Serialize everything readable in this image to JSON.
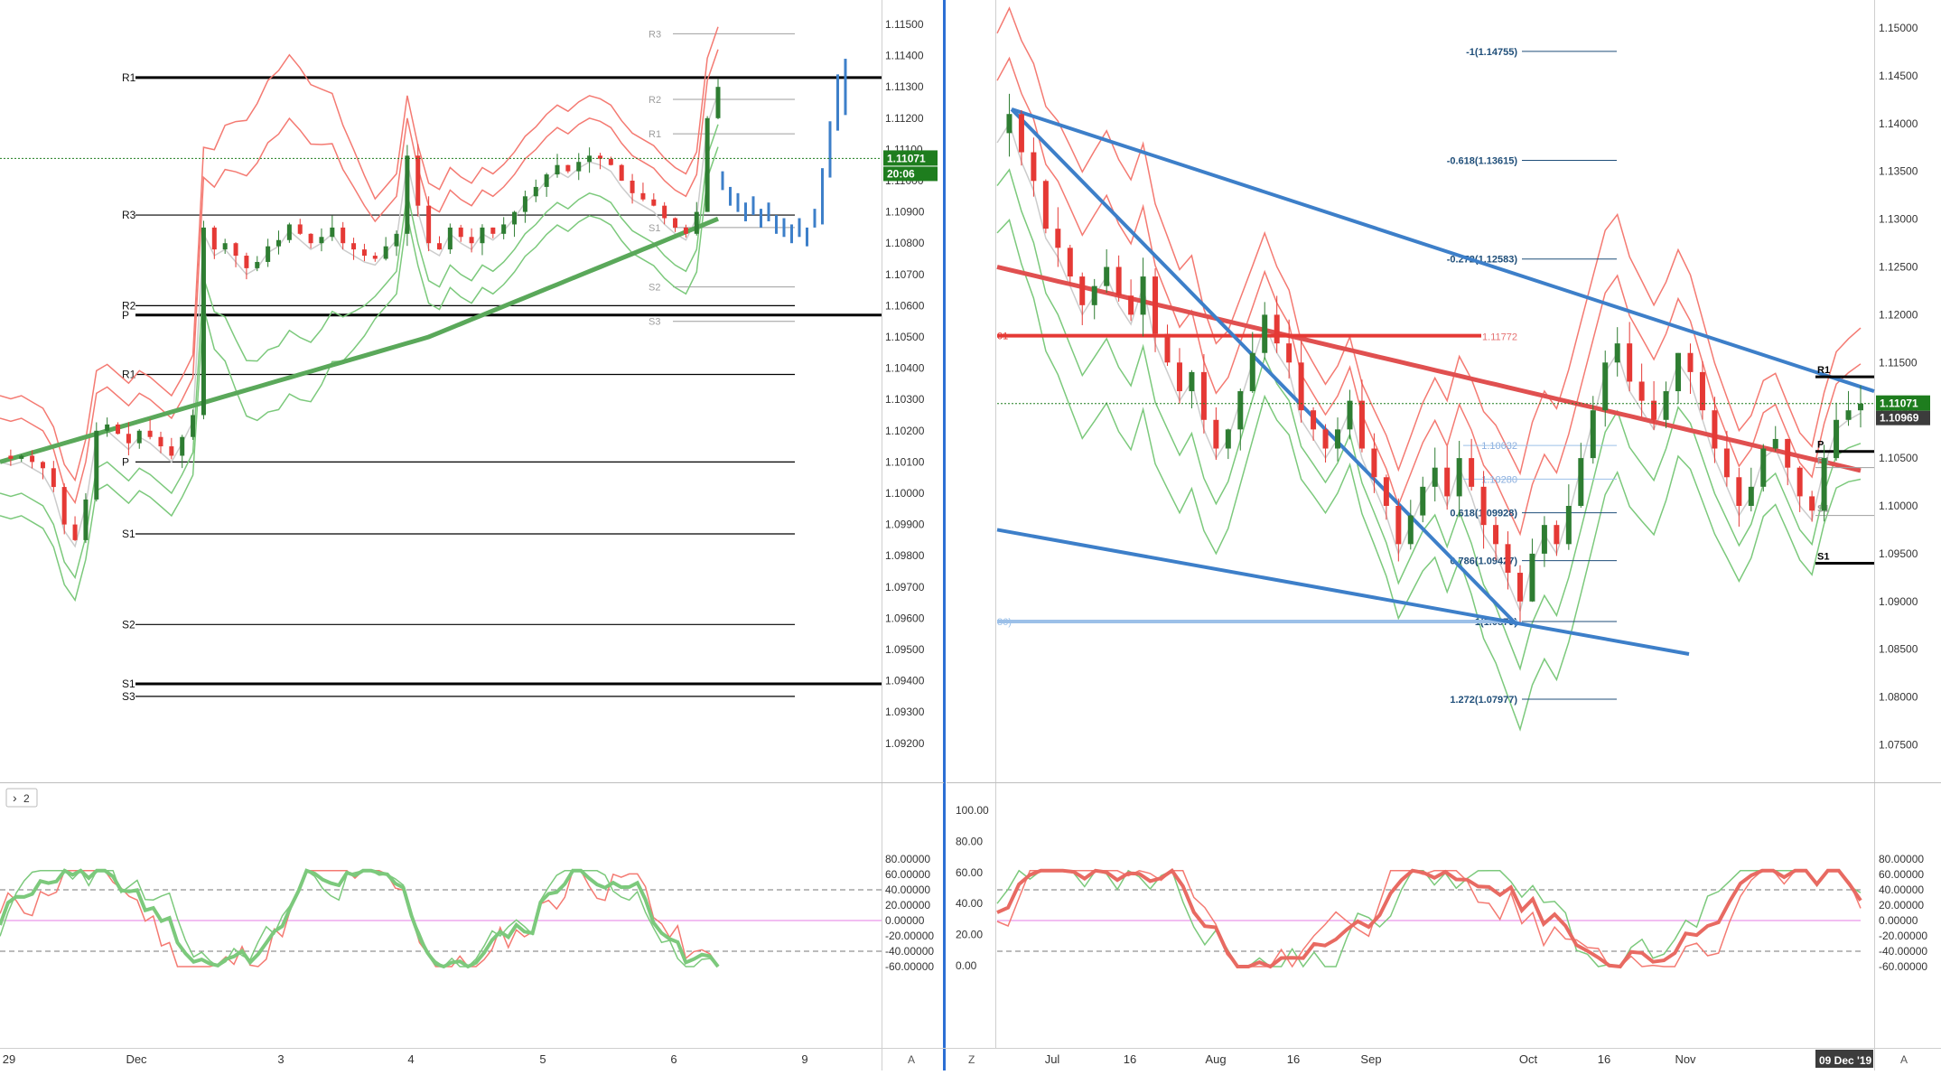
{
  "colors": {
    "up": "#2e7d32",
    "down": "#e53935",
    "blue": "#3d7fc9",
    "pivot": "#000000",
    "band_red": "#f47a72",
    "band_green": "#7cc97c",
    "price_line": "#1f8f1f",
    "osc_mid": "#e47ce4",
    "osc_lvl": "#777777",
    "badge_green": "#1e7d1e",
    "badge_gray": "#3c3c3c",
    "grid_sep": "#2c6fd4"
  },
  "left_panel": {
    "price_axis_ticks": [
      "1.11500",
      "1.11400",
      "1.11300",
      "1.11200",
      "1.11100",
      "1.11000",
      "1.10900",
      "1.10800",
      "1.10700",
      "1.10600",
      "1.10500",
      "1.10400",
      "1.10300",
      "1.10200",
      "1.10100",
      "1.10000",
      "1.09900",
      "1.09800",
      "1.09700",
      "1.09600",
      "1.09500",
      "1.09400",
      "1.09300",
      "1.09200"
    ],
    "time_axis": [
      "29",
      "Dec",
      "3",
      "4",
      "5",
      "6",
      "9"
    ],
    "last_price": "1.11071",
    "countdown": "20:06",
    "pivot_labels": [
      "R1",
      "R3",
      "R2",
      "P",
      "R1",
      "P",
      "S1",
      "S2",
      "S1",
      "S3"
    ],
    "faint_pivot_labels": [
      "R3",
      "R2",
      "R1",
      "S1",
      "S2",
      "S3"
    ],
    "osc_ticks": [
      "80.00000",
      "60.00000",
      "40.00000",
      "20.00000",
      "0.00000",
      "-20.00000",
      "-40.00000",
      "-60.00000"
    ],
    "osc_tag": "2",
    "scale_btn": "A"
  },
  "right_panel": {
    "price_axis_ticks": [
      "1.15000",
      "1.14500",
      "1.14000",
      "1.13500",
      "1.13000",
      "1.12500",
      "1.12000",
      "1.11500",
      "1.11000",
      "1.10500",
      "1.10000",
      "1.09500",
      "1.09000",
      "1.08500",
      "1.08000",
      "1.07500"
    ],
    "time_axis": [
      "Jul",
      "16",
      "Aug",
      "16",
      "Sep",
      "Oct",
      "16",
      "Nov"
    ],
    "last_price": "1.11071",
    "prev_price": "1.10969",
    "fib_labels": [
      "-1(1.14755)",
      "-0.618(1.13615)",
      "-0.272(1.12583)",
      "0.618(1.09928)",
      "0.786(1.09427)",
      "1(1.0879)",
      "1.272(1.07977)",
      "1.10632",
      "1.10280",
      "1.11772",
      "01",
      "86)"
    ],
    "pivot_labels": [
      "R1",
      "P",
      "R1",
      "S1",
      "S1"
    ],
    "date_badge": "09 Dec '19",
    "osc_ticks_left": [
      "100.00",
      "80.00",
      "60.00",
      "40.00",
      "20.00",
      "0.00"
    ],
    "osc_ticks_right": [
      "80.00000",
      "60.00000",
      "40.00000",
      "20.00000",
      "0.00000",
      "-20.00000",
      "-40.00000",
      "-60.00000"
    ],
    "zoom_btn": "Z",
    "scale_btn": "A"
  },
  "chart_data": [
    {
      "type": "candlestick",
      "panel": "left",
      "title": "",
      "xlabel": "",
      "ylabel": "",
      "x_ticks": [
        "29",
        "Dec",
        "3",
        "4",
        "5",
        "6",
        "9"
      ],
      "ylim": [
        1.0915,
        1.1155
      ],
      "pivot_levels": [
        {
          "name": "R1",
          "value": 1.1133
        },
        {
          "name": "R3",
          "value": 1.1089
        },
        {
          "name": "R2",
          "value": 1.106
        },
        {
          "name": "P",
          "value": 1.1057
        },
        {
          "name": "R1",
          "value": 1.1038
        },
        {
          "name": "P",
          "value": 1.101
        },
        {
          "name": "S1",
          "value": 1.0987
        },
        {
          "name": "S2",
          "value": 1.0958
        },
        {
          "name": "S1",
          "value": 1.0939
        },
        {
          "name": "S3",
          "value": 1.0935
        }
      ],
      "last_price": 1.11071,
      "close_path": [
        1.1012,
        1.1011,
        1.1012,
        1.101,
        1.1008,
        1.1002,
        1.099,
        1.0985,
        1.0998,
        1.102,
        1.1022,
        1.1019,
        1.1016,
        1.102,
        1.1018,
        1.1015,
        1.1012,
        1.1018,
        1.1025,
        1.1085,
        1.1078,
        1.108,
        1.1076,
        1.1072,
        1.1074,
        1.1079,
        1.1081,
        1.1086,
        1.1083,
        1.108,
        1.1082,
        1.1085,
        1.108,
        1.1078,
        1.1076,
        1.1075,
        1.1079,
        1.1083,
        1.1108,
        1.1092,
        1.108,
        1.1078,
        1.1085,
        1.1082,
        1.108,
        1.1085,
        1.1083,
        1.1086,
        1.109,
        1.1095,
        1.1098,
        1.1102,
        1.1105,
        1.1103,
        1.1106,
        1.1108,
        1.1107,
        1.1105,
        1.11,
        1.1096,
        1.1094,
        1.1092,
        1.1088,
        1.1085,
        1.1083,
        1.109,
        1.112,
        1.113
      ]
    },
    {
      "type": "candlestick",
      "panel": "right",
      "title": "",
      "xlabel": "",
      "ylabel": "",
      "x_ticks": [
        "Jul",
        "16",
        "Aug",
        "16",
        "Sep",
        "Oct",
        "16",
        "Nov"
      ],
      "ylim": [
        1.0725,
        1.1525
      ],
      "fib_levels": [
        {
          "ratio": "-1",
          "value": 1.14755
        },
        {
          "ratio": "-0.618",
          "value": 1.13615
        },
        {
          "ratio": "-0.272",
          "value": 1.12583
        },
        {
          "ratio": "0.618",
          "value": 1.09928
        },
        {
          "ratio": "0.786",
          "value": 1.09427
        },
        {
          "ratio": "1",
          "value": 1.0879
        },
        {
          "ratio": "1.272",
          "value": 1.07977
        }
      ],
      "last_price": 1.11071,
      "prev_price": 1.10969,
      "close_path": [
        1.139,
        1.141,
        1.137,
        1.134,
        1.129,
        1.127,
        1.124,
        1.121,
        1.123,
        1.125,
        1.122,
        1.12,
        1.124,
        1.118,
        1.115,
        1.112,
        1.114,
        1.109,
        1.106,
        1.108,
        1.112,
        1.116,
        1.12,
        1.117,
        1.115,
        1.11,
        1.108,
        1.106,
        1.108,
        1.111,
        1.106,
        1.103,
        1.1,
        1.096,
        1.099,
        1.102,
        1.104,
        1.101,
        1.105,
        1.102,
        1.098,
        1.096,
        1.093,
        1.09,
        1.095,
        1.098,
        1.096,
        1.1,
        1.105,
        1.11,
        1.115,
        1.117,
        1.113,
        1.111,
        1.109,
        1.112,
        1.116,
        1.114,
        1.11,
        1.106,
        1.103,
        1.1,
        1.102,
        1.106,
        1.107,
        1.104,
        1.101,
        1.0995,
        1.105,
        1.109,
        1.11,
        1.1107
      ]
    }
  ]
}
